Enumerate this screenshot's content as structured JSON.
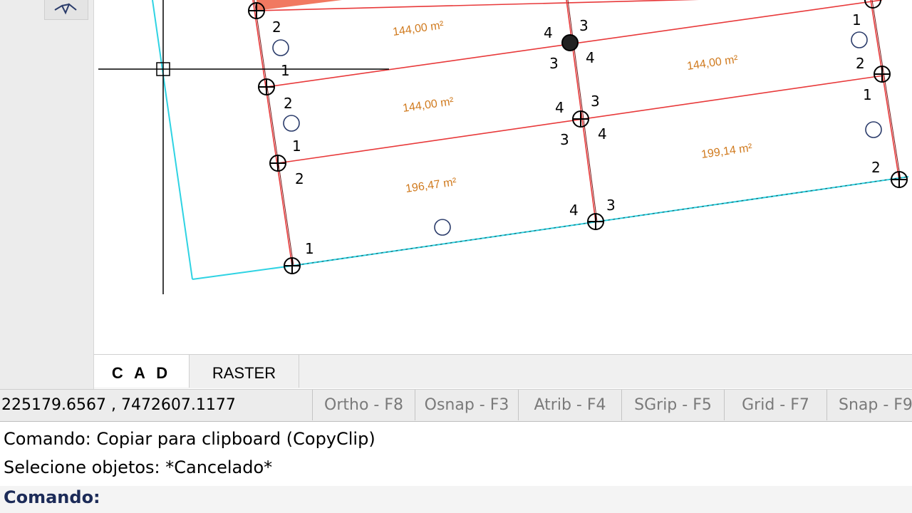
{
  "drawing": {
    "areas": [
      {
        "label": "144,00 m²"
      },
      {
        "label": "144,00 m²"
      },
      {
        "label": "144,00 m²"
      },
      {
        "label": "199,14 m²"
      },
      {
        "label": "196,47 m²"
      }
    ],
    "vertex_numbers": [
      "2",
      "1",
      "2",
      "1",
      "2",
      "1",
      "4",
      "3",
      "3",
      "4",
      "4",
      "3",
      "3",
      "4",
      "4",
      "3",
      "1",
      "2",
      "1",
      "2"
    ],
    "colors": {
      "lot_line": "#e8393a",
      "boundary": "#2fd3e3",
      "area_text": "#d07a1e",
      "crosshair": "#000000",
      "highlight_fill": "#f06a50"
    }
  },
  "tabs": [
    {
      "label": "C A D"
    },
    {
      "label": "RASTER"
    }
  ],
  "status_bar": {
    "coordinates": "225179.6567 , 7472607.1177",
    "toggles": [
      {
        "label": "Ortho - F8"
      },
      {
        "label": "Osnap - F3"
      },
      {
        "label": "Atrib - F4"
      },
      {
        "label": "SGrip - F5"
      },
      {
        "label": "Grid - F7"
      },
      {
        "label": "Snap - F9"
      }
    ]
  },
  "command": {
    "history": [
      "Comando: Copiar para clipboard (CopyClip)",
      "Selecione objetos: *Cancelado*"
    ],
    "prompt": "Comando:"
  }
}
